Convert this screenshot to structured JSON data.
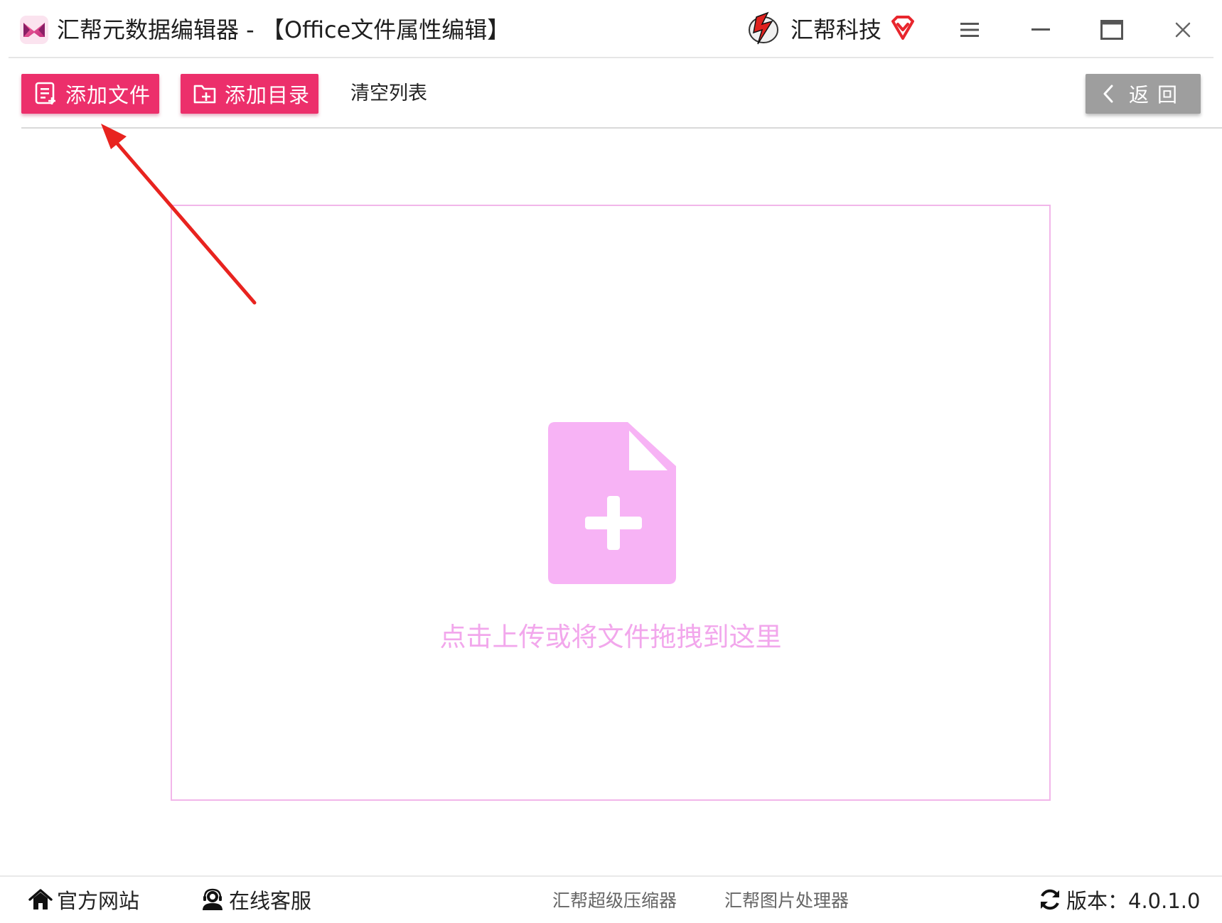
{
  "window": {
    "title": "汇帮元数据编辑器 - 【Office文件属性编辑】",
    "brand": "汇帮科技",
    "controls": {
      "menu_icon": "hamburger-menu-icon",
      "minimize_icon": "minimize-icon",
      "maximize_icon": "maximize-icon",
      "close_icon": "close-icon"
    }
  },
  "toolbar": {
    "add_file_label": "添加文件",
    "add_dir_label": "添加目录",
    "clear_label": "清空列表",
    "back_label": "返回"
  },
  "dropzone": {
    "hint": "点击上传或将文件拖拽到这里",
    "icon": "file-add-icon"
  },
  "footer": {
    "website": "官方网站",
    "support": "在线客服",
    "compressor": "汇帮超级压缩器",
    "image_processor": "汇帮图片处理器",
    "version": "版本：4.0.1.0"
  },
  "colors": {
    "accent": "#ec2f6b",
    "dropzone_border": "#f2b6ea",
    "dropzone_icon": "#f7b3f5",
    "hint_text": "#f2a7ec",
    "back_button": "#9e9e9e",
    "annotation_arrow": "#e8231f"
  }
}
